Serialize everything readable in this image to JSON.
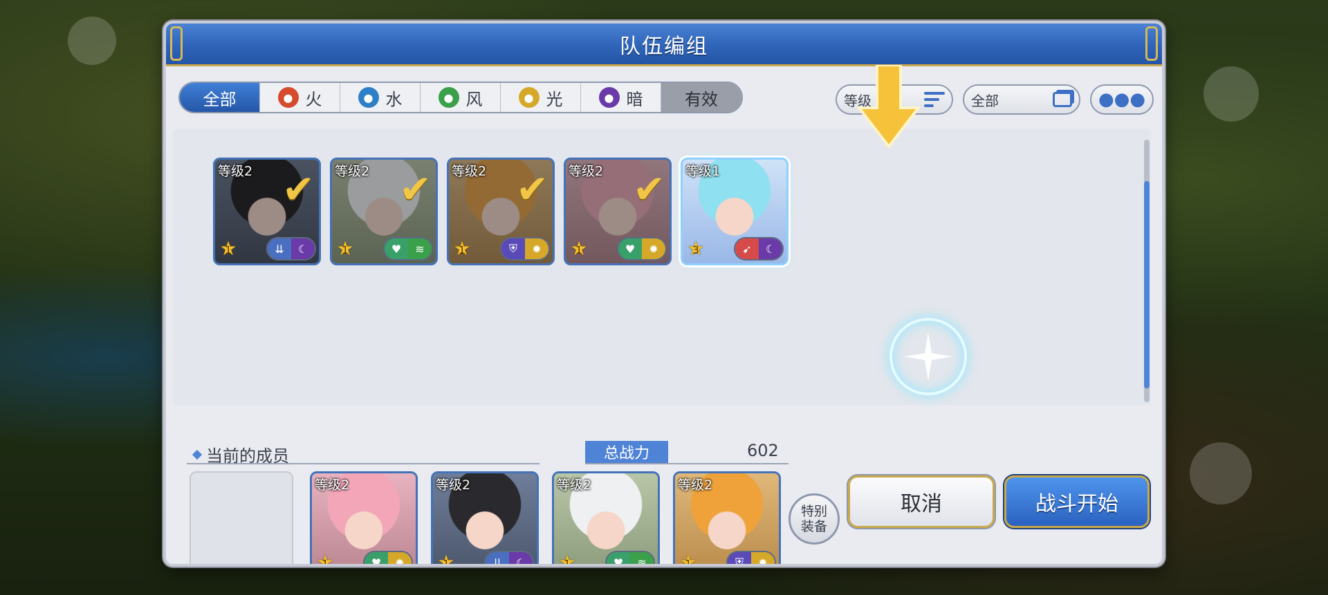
{
  "modal": {
    "title": "队伍编组"
  },
  "tabs": [
    {
      "label": "全部",
      "icon": "all-icon",
      "active": true
    },
    {
      "label": "火",
      "icon": "fire-element-icon",
      "color": "#d64a2e"
    },
    {
      "label": "水",
      "icon": "water-element-icon",
      "color": "#2f7fc8"
    },
    {
      "label": "风",
      "icon": "wind-element-icon",
      "color": "#3aa04a"
    },
    {
      "label": "光",
      "icon": "light-element-icon",
      "color": "#d6a82a"
    },
    {
      "label": "暗",
      "icon": "dark-element-icon",
      "color": "#6a3aa8"
    },
    {
      "label": "有效",
      "icon": "",
      "dim": true
    }
  ],
  "sort": {
    "label": "等级",
    "icon": "sort-icon"
  },
  "filter": {
    "label": "全部",
    "icon": "cards-icon"
  },
  "roster": [
    {
      "level": "等级2",
      "stars": "1",
      "role_icon": "speed-down-icon",
      "element_icon": "dark-element-icon",
      "checked": true,
      "hair": "#2a2a2e",
      "bg1": "#6f7e99",
      "bg2": "#4a556a",
      "role_color": "#4a6fc0",
      "element_color": "#6a3aa8"
    },
    {
      "level": "等级2",
      "stars": "1",
      "role_icon": "heal-icon",
      "element_icon": "wind-element-icon",
      "checked": true,
      "hair": "#eef0f2",
      "bg1": "#b9c6a8",
      "bg2": "#8a9a7a",
      "role_color": "#3aa06a",
      "element_color": "#3aa04a"
    },
    {
      "level": "等级2",
      "stars": "1",
      "role_icon": "shield-icon",
      "element_icon": "light-element-icon",
      "checked": true,
      "hair": "#f0a23a",
      "bg1": "#e0b87a",
      "bg2": "#b88a4a",
      "role_color": "#5a4ab8",
      "element_color": "#d6a82a"
    },
    {
      "level": "等级2",
      "stars": "1",
      "role_icon": "heal-icon",
      "element_icon": "light-element-icon",
      "checked": true,
      "hair": "#f2a6b8",
      "bg1": "#e8b3c0",
      "bg2": "#b8848f",
      "role_color": "#3aa06a",
      "element_color": "#d6a82a"
    },
    {
      "level": "等级1",
      "stars": "3",
      "role_icon": "attack-icon",
      "element_icon": "dark-element-icon",
      "checked": false,
      "selected": true,
      "hair": "#8fe0f0",
      "bg1": "#cfe2f7",
      "bg2": "#9ab8e8",
      "role_color": "#d64a4a",
      "element_color": "#6a3aa8"
    }
  ],
  "current_members": {
    "label": "当前的成员",
    "power_label": "总战力",
    "power_value": "602",
    "members": [
      {
        "level": "等级2",
        "stars": "1",
        "role_icon": "heal-icon",
        "element_icon": "light-element-icon",
        "hair": "#f2a6b8",
        "bg1": "#e8b3c0",
        "bg2": "#b8848f",
        "role_color": "#3aa06a",
        "element_color": "#d6a82a"
      },
      {
        "level": "等级2",
        "stars": "1",
        "role_icon": "speed-down-icon",
        "element_icon": "dark-element-icon",
        "hair": "#2a2a2e",
        "bg1": "#6f7e99",
        "bg2": "#4a556a",
        "role_color": "#4a6fc0",
        "element_color": "#6a3aa8"
      },
      {
        "level": "等级2",
        "stars": "1",
        "role_icon": "heal-icon",
        "element_icon": "wind-element-icon",
        "hair": "#eef0f2",
        "bg1": "#b9c6a8",
        "bg2": "#8a9a7a",
        "role_color": "#3aa06a",
        "element_color": "#3aa04a"
      },
      {
        "level": "等级2",
        "stars": "1",
        "role_icon": "shield-icon",
        "element_icon": "light-element-icon",
        "hair": "#f0a23a",
        "bg1": "#e0b87a",
        "bg2": "#b88a4a",
        "role_color": "#5a4ab8",
        "element_color": "#d6a82a"
      }
    ]
  },
  "buttons": {
    "special": "特别装备",
    "cancel": "取消",
    "start": "战斗开始"
  }
}
